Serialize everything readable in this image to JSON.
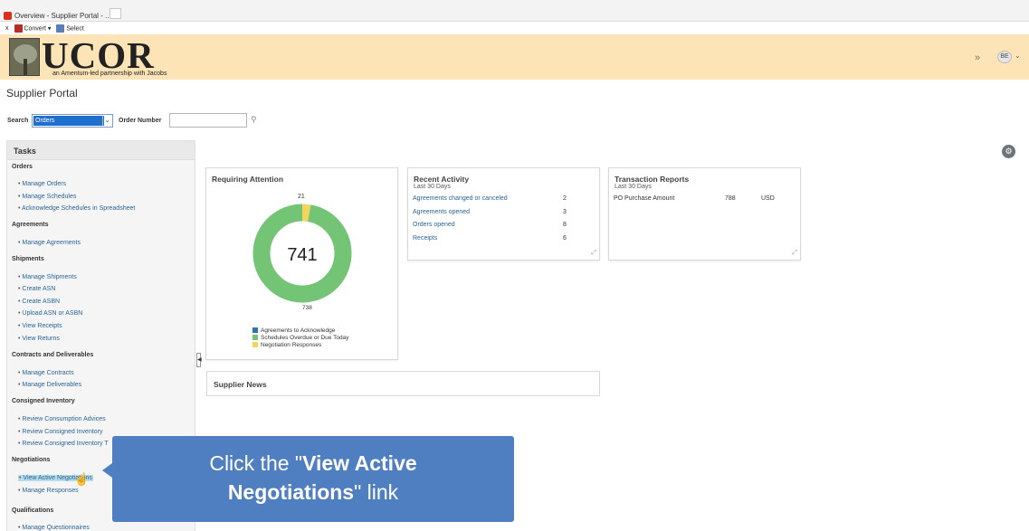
{
  "browser": {
    "tab_title": "Overview - Supplier Portal - ...",
    "tab_close": "×",
    "toolbar_x": "x",
    "convert_label": "Convert",
    "convert_chev": "▾",
    "select_label": "Select"
  },
  "header": {
    "logo_text": "UCOR",
    "logo_subtitle": "an Amentum-led partnership with Jacobs",
    "expand_icon": "»",
    "user_initials": "BE",
    "user_chevron": "⌄"
  },
  "page": {
    "title": "Supplier Portal"
  },
  "search": {
    "label": "Search",
    "selected": "Orders",
    "chevron": "⌄",
    "order_number_label": "Order Number",
    "order_number_value": ""
  },
  "tasks": {
    "header": "Tasks",
    "sections": [
      {
        "title": "Orders",
        "links": [
          "Manage Orders",
          "Manage Schedules",
          "Acknowledge Schedules in Spreadsheet"
        ]
      },
      {
        "title": "Agreements",
        "links": [
          "Manage Agreements"
        ]
      },
      {
        "title": "Shipments",
        "links": [
          "Manage Shipments",
          "Create ASN",
          "Create ASBN",
          "Upload ASN or ASBN",
          "View Receipts",
          "View Returns"
        ]
      },
      {
        "title": "Contracts and Deliverables",
        "links": [
          "Manage Contracts",
          "Manage Deliverables"
        ]
      },
      {
        "title": "Consigned Inventory",
        "links": [
          "Review Consumption Advices",
          "Review Consigned Inventory",
          "Review Consigned Inventory T"
        ]
      },
      {
        "title": "Negotiations",
        "links": [
          "View Active Negotiations",
          "Manage Responses"
        ]
      },
      {
        "title": "Qualifications",
        "links": [
          "Manage Questionnaires"
        ]
      }
    ]
  },
  "requiring_attention": {
    "title": "Requiring Attention",
    "total": "741",
    "label_top": "21",
    "label_bottom": "738",
    "segments": [
      {
        "name": "Agreements to Acknowledge",
        "value": 0,
        "color": "#2f74b0"
      },
      {
        "name": "Schedules Overdue or Due Today",
        "value": 738,
        "color": "#74c476"
      },
      {
        "name": "Negotiation Responses",
        "value": 21,
        "color": "#f2d65c"
      }
    ]
  },
  "recent_activity": {
    "title": "Recent Activity",
    "subtitle": "Last 30 Days",
    "rows": [
      {
        "label": "Agreements changed or canceled",
        "value": "2"
      },
      {
        "label": "Agreements opened",
        "value": "3"
      },
      {
        "label": "Orders opened",
        "value": "8"
      },
      {
        "label": "Receipts",
        "value": "6"
      }
    ]
  },
  "transaction_reports": {
    "title": "Transaction Reports",
    "subtitle": "Last 30 Days",
    "row_label": "PO Purchase Amount",
    "row_value": "788",
    "row_currency": "USD"
  },
  "supplier_news": {
    "title": "Supplier News"
  },
  "callout": {
    "line1_pre": "Click the \"",
    "line1_bold": "View Active",
    "line2_bold": "Negotiations",
    "line2_post": "\" link"
  },
  "colors": {
    "banner": "#fce4b6",
    "link": "#2a6496",
    "callout": "#4f7fc0"
  }
}
